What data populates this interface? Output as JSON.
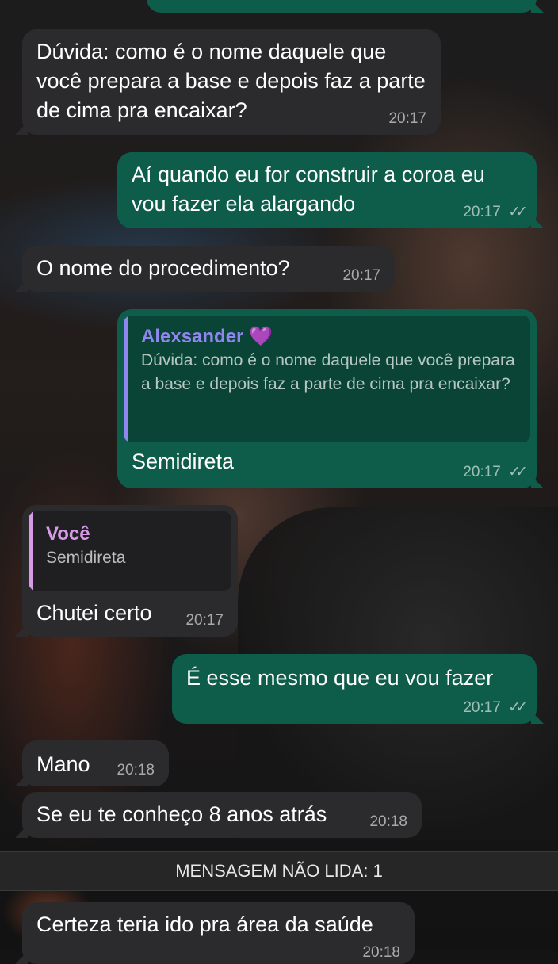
{
  "messages": [
    {
      "text": "Dúvida: como é o nome daquele que você prepara a base e depois faz a parte de cima pra encaixar?",
      "time": "20:17",
      "direction": "in"
    },
    {
      "text": "Aí quando eu for construir a coroa eu vou fazer ela alargando",
      "time": "20:17",
      "direction": "out",
      "read": true
    },
    {
      "text": "O nome do procedimento?",
      "time": "20:17",
      "direction": "in"
    },
    {
      "text": "Semidireta",
      "time": "20:17",
      "direction": "out",
      "read": true,
      "quote": {
        "author": "Alexsander 💜",
        "text": "Dúvida: como é o nome daquele que você prepara a base e depois faz a parte de cima pra encaixar?"
      }
    },
    {
      "text": "Chutei certo",
      "time": "20:17",
      "direction": "in",
      "quote": {
        "author": "Você",
        "text": "Semidireta"
      }
    },
    {
      "text": "É esse mesmo que eu vou fazer",
      "time": "20:17",
      "direction": "out",
      "read": true
    },
    {
      "text": "Mano",
      "time": "20:18",
      "direction": "in"
    },
    {
      "text": "Se eu te conheço 8 anos atrás",
      "time": "20:18",
      "direction": "in"
    },
    {
      "text": "Certeza teria ido pra área da saúde",
      "time": "20:18",
      "direction": "in"
    }
  ],
  "unread_banner": "MENSAGEM NÃO LIDA: 1",
  "colors": {
    "incoming_bubble": "#2b2b2d",
    "outgoing_bubble": "#0e5c4a",
    "quote_accent_alexsander": "#8f86f0",
    "quote_accent_voce": "#d79be6"
  },
  "icons": {
    "read_receipt": "double-check-icon"
  }
}
